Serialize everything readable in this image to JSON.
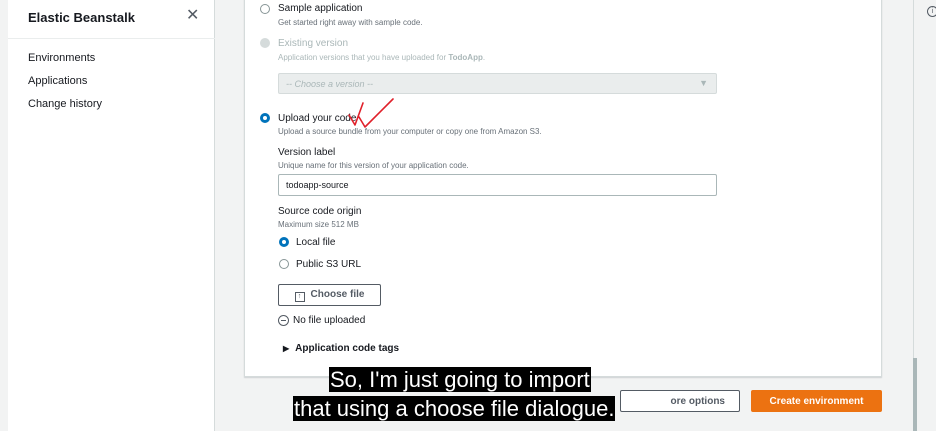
{
  "sidebar": {
    "title": "Elastic Beanstalk",
    "close_glyph": "✕",
    "items": [
      {
        "label": "Environments"
      },
      {
        "label": "Applications"
      },
      {
        "label": "Change history"
      }
    ]
  },
  "code_source": {
    "sample": {
      "label": "Sample application",
      "description": "Get started right away with sample code."
    },
    "existing": {
      "label": "Existing version",
      "description_prefix": "Application versions that you have uploaded for ",
      "app_name": "TodoApp",
      "description_suffix": ".",
      "select_placeholder": "-- Choose a version --",
      "caret": "▼"
    },
    "upload": {
      "label": "Upload your code",
      "description": "Upload a source bundle from your computer or copy one from Amazon S3.",
      "selected": true
    }
  },
  "version_label": {
    "label": "Version label",
    "description": "Unique name for this version of your application code.",
    "value": "todoapp-source"
  },
  "source_origin": {
    "label": "Source code origin",
    "description": "Maximum size 512 MB",
    "options": [
      {
        "label": "Local file",
        "selected": true
      },
      {
        "label": "Public S3 URL",
        "selected": false
      }
    ],
    "choose_file_label": "Choose file",
    "choose_file_icon": "upload-icon",
    "no_file_text": "No file uploaded"
  },
  "tags": {
    "label": "Application code tags",
    "toggle_glyph": "▶"
  },
  "footer": {
    "more_options_label": "ore options",
    "create_label": "Create environment"
  },
  "info_icon_glyph": "i",
  "captions": [
    "So, I'm just going to import",
    "that using a choose file dialogue."
  ],
  "colors": {
    "primary_blue": "#0073bb",
    "orange": "#ec7211",
    "annotation_red": "#e0202a"
  }
}
